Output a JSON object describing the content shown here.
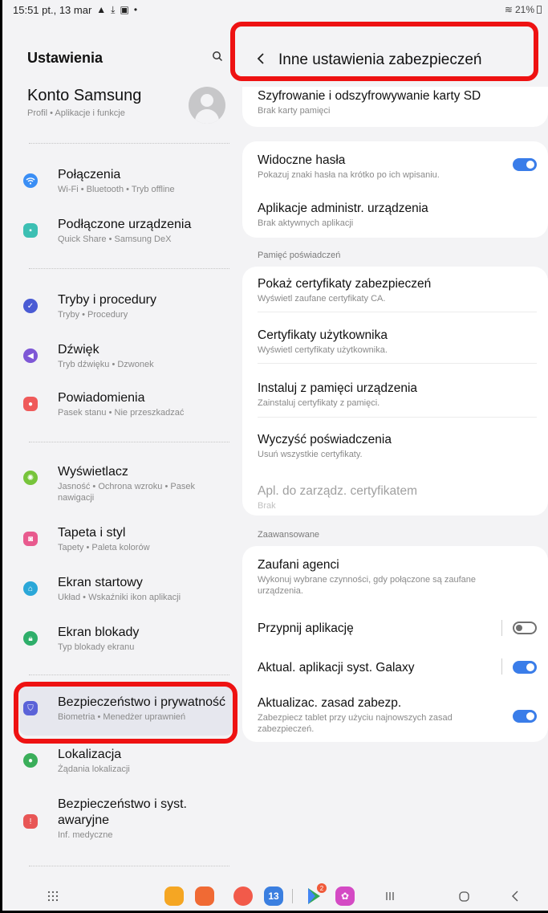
{
  "status_bar": {
    "time_date": "15:51 pt., 13 mar",
    "icons": [
      "warning-triangle-icon",
      "download-icon",
      "image-icon",
      "dot-icon"
    ],
    "battery": "21%"
  },
  "left": {
    "title": "Ustawienia",
    "account": {
      "name": "Konto Samsung",
      "sub": "Profil • Aplikacje i funkcje"
    },
    "items": [
      {
        "title": "Połączenia",
        "sub": "Wi-Fi • Bluetooth • Tryb offline",
        "icon": "wifi-icon",
        "color": "#3a8ef5"
      },
      {
        "title": "Podłączone urządzenia",
        "sub": "Quick Share • Samsung DeX",
        "icon": "devices-icon",
        "color": "#3cbfb3"
      },
      {
        "title": "Tryby i procedury",
        "sub": "Tryby • Procedury",
        "icon": "check-circle-icon",
        "color": "#4a5bd4"
      },
      {
        "title": "Dźwięk",
        "sub": "Tryb dźwięku • Dzwonek",
        "icon": "volume-icon",
        "color": "#7e57d6"
      },
      {
        "title": "Powiadomienia",
        "sub": "Pasek stanu • Nie przeszkadzać",
        "icon": "bell-icon",
        "color": "#ef5a5a"
      },
      {
        "title": "Wyświetlacz",
        "sub": "Jasność • Ochrona wzroku • Pasek nawigacji",
        "icon": "sun-icon",
        "color": "#77c43b"
      },
      {
        "title": "Tapeta i styl",
        "sub": "Tapety • Paleta kolorów",
        "icon": "palette-icon",
        "color": "#e85a8e"
      },
      {
        "title": "Ekran startowy",
        "sub": "Układ • Wskaźniki ikon aplikacji",
        "icon": "home-icon",
        "color": "#2aa7d8"
      },
      {
        "title": "Ekran blokady",
        "sub": "Typ blokady ekranu",
        "icon": "lock-icon",
        "color": "#2eae6a"
      },
      {
        "title": "Bezpieczeństwo i prywatność",
        "sub": "Biometria • Menedżer uprawnień",
        "icon": "shield-icon",
        "color": "#5b63d8"
      },
      {
        "title": "Lokalizacja",
        "sub": "Żądania lokalizacji",
        "icon": "location-pin-icon",
        "color": "#3aae5a"
      },
      {
        "title": "Bezpieczeństwo i syst. awaryjne",
        "sub": "Inf. medyczne",
        "icon": "emergency-icon",
        "color": "#e85656"
      }
    ]
  },
  "right": {
    "title": "Inne ustawienia zabezpieczeń",
    "rows": [
      {
        "title": "Szyfrowanie i odszyfrowywanie karty SD",
        "sub": "Brak karty pamięci"
      },
      {
        "title": "Widoczne hasła",
        "sub": "Pokazuj znaki hasła na krótko po ich wpisaniu.",
        "toggle": "on"
      },
      {
        "title": "Aplikacje administr. urządzenia",
        "sub": "Brak aktywnych aplikacji"
      },
      {
        "title": "Pokaż certyfikaty zabezpieczeń",
        "sub": "Wyświetl zaufane certyfikaty CA."
      },
      {
        "title": "Certyfikaty użytkownika",
        "sub": "Wyświetl certyfikaty użytkownika."
      },
      {
        "title": "Instaluj z pamięci urządzenia",
        "sub": "Zainstaluj certyfikaty z pamięci."
      },
      {
        "title": "Wyczyść poświadczenia",
        "sub": "Usuń wszystkie certyfikaty."
      },
      {
        "title": "Apl. do zarządz. certyfikatem",
        "sub": "Brak"
      },
      {
        "title": "Zaufani agenci",
        "sub": "Wykonuj wybrane czynności, gdy połączone są zaufane urządzenia."
      },
      {
        "title": "Przypnij aplikację",
        "toggle": "off"
      },
      {
        "title": "Aktual. aplikacji syst. Galaxy",
        "toggle": "on"
      },
      {
        "title": "Aktualizac. zasad zabezp.",
        "sub": "Zabezpiecz tablet przy użyciu najnowszych zasad zabezpieczeń.",
        "toggle": "on"
      }
    ],
    "sections": {
      "credentials": "Pamięć poświadczeń",
      "advanced": "Zaawansowane"
    }
  },
  "navbar": {
    "apps": [
      {
        "name": "apps-grid-icon"
      },
      {
        "name": "folder-app-icon",
        "color": "#f5a623"
      },
      {
        "name": "notes-app-icon",
        "color": "#f06a34"
      },
      {
        "name": "contacts-app-icon",
        "color": "#f25a4a"
      },
      {
        "name": "calendar-app-icon",
        "color": "#3b7fe0",
        "label": "13"
      },
      {
        "name": "play-store-icon",
        "badge": "2"
      },
      {
        "name": "blossom-app-icon",
        "color": "#d44ac4"
      }
    ],
    "keys": [
      "recents-key",
      "home-key",
      "back-key"
    ]
  }
}
